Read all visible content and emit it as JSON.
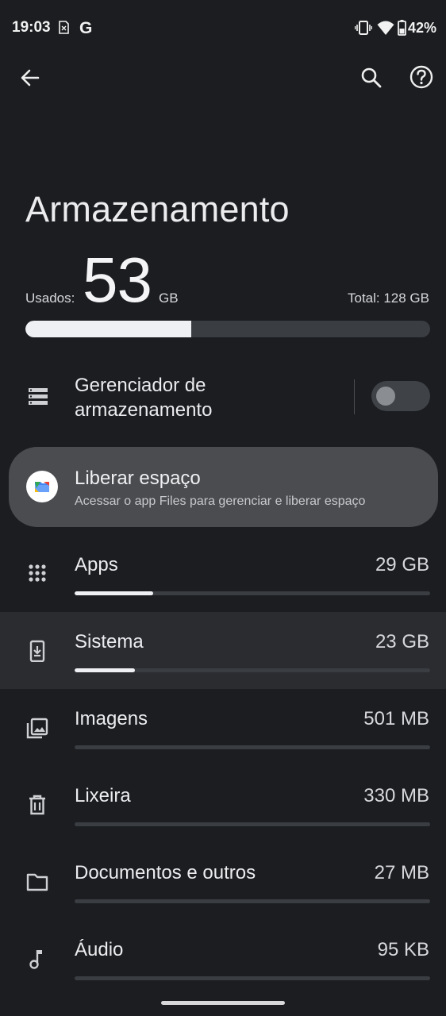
{
  "status_bar": {
    "time": "19:03",
    "g_label": "G",
    "battery": "42%"
  },
  "page": {
    "title": "Armazenamento"
  },
  "usage": {
    "used_label": "Usados:",
    "used_value": "53",
    "used_unit": "GB",
    "total_label": "Total: 128 GB",
    "used_fraction": 0.41
  },
  "manager": {
    "label": "Gerenciador de armazenamento",
    "enabled": false
  },
  "free_up": {
    "title": "Liberar espaço",
    "subtitle": "Acessar o app Files para gerenciar e liberar espaço"
  },
  "categories": [
    {
      "label": "Apps",
      "size": "29 GB",
      "icon": "apps-grid-icon",
      "fraction": 0.22
    },
    {
      "label": "Sistema",
      "size": "23 GB",
      "icon": "system-phone-icon",
      "fraction": 0.17
    },
    {
      "label": "Imagens",
      "size": "501 MB",
      "icon": "images-icon",
      "fraction": 0
    },
    {
      "label": "Lixeira",
      "size": "330 MB",
      "icon": "trash-icon",
      "fraction": 0
    },
    {
      "label": "Documentos e outros",
      "size": "27 MB",
      "icon": "folder-icon",
      "fraction": 0
    },
    {
      "label": "Áudio",
      "size": "95 KB",
      "icon": "music-note-icon",
      "fraction": 0
    }
  ],
  "colors": {
    "background": "#1b1d20",
    "card": "#4a4c50",
    "bar_fill": "#eef0f4",
    "bar_track": "#3a3d42"
  }
}
